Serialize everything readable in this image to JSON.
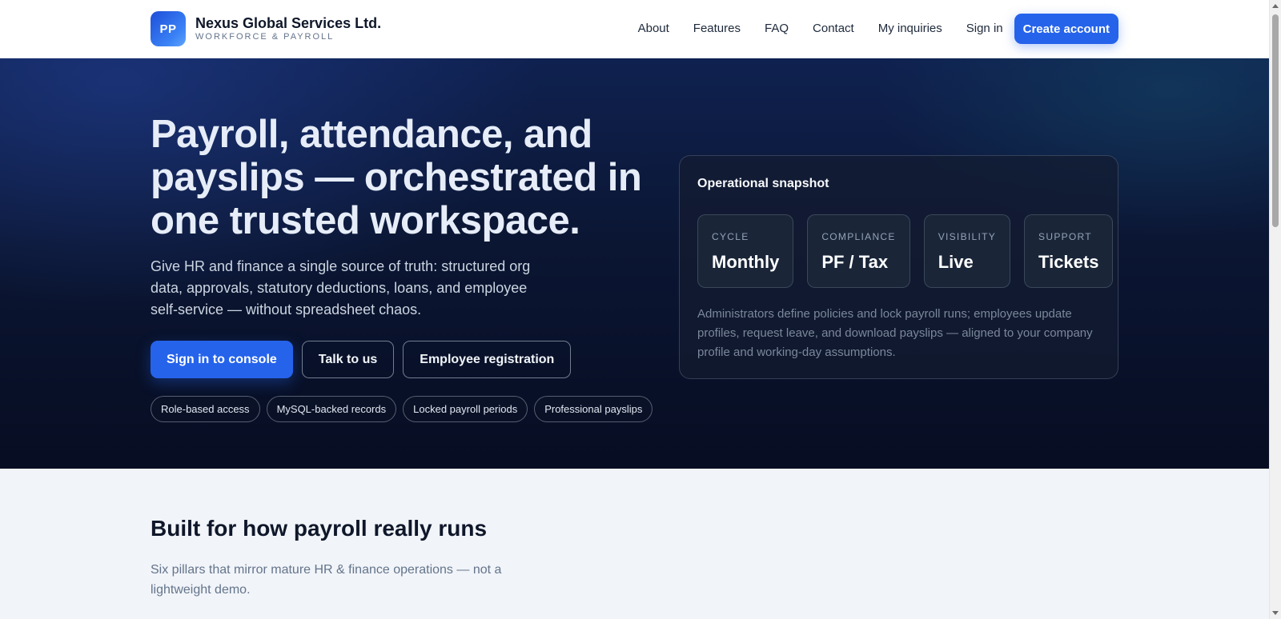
{
  "header": {
    "logo_text": "PP",
    "brand_name": "Nexus Global Services Ltd.",
    "brand_sub": "WORKFORCE & PAYROLL",
    "nav": [
      "About",
      "Features",
      "FAQ",
      "Contact",
      "My inquiries",
      "Sign in"
    ],
    "create_account": "Create account"
  },
  "hero": {
    "title": "Payroll, attendance, and payslips — orchestrated in one trusted workspace.",
    "description": "Give HR and finance a single source of truth: structured org data, approvals, statutory deductions, loans, and employee self-service — without spreadsheet chaos.",
    "buttons": {
      "primary": "Sign in to console",
      "talk": "Talk to us",
      "register": "Employee registration"
    },
    "pills": [
      "Role-based access",
      "MySQL-backed records",
      "Locked payroll periods",
      "Professional payslips"
    ]
  },
  "snapshot": {
    "title": "Operational snapshot",
    "stats": [
      {
        "label": "CYCLE",
        "value": "Monthly"
      },
      {
        "label": "COMPLIANCE",
        "value": "PF / Tax"
      },
      {
        "label": "VISIBILITY",
        "value": "Live"
      },
      {
        "label": "SUPPORT",
        "value": "Tickets"
      }
    ],
    "description": "Administrators define policies and lock payroll runs; employees update profiles, request leave, and download payslips — aligned to your company profile and working-day assumptions."
  },
  "section": {
    "title": "Built for how payroll really runs",
    "description": "Six pillars that mirror mature HR & finance operations — not a lightweight demo."
  },
  "colors": {
    "accent": "#2563eb",
    "hero_bg": "#0b1633",
    "page_bg": "#f1f4f9"
  }
}
